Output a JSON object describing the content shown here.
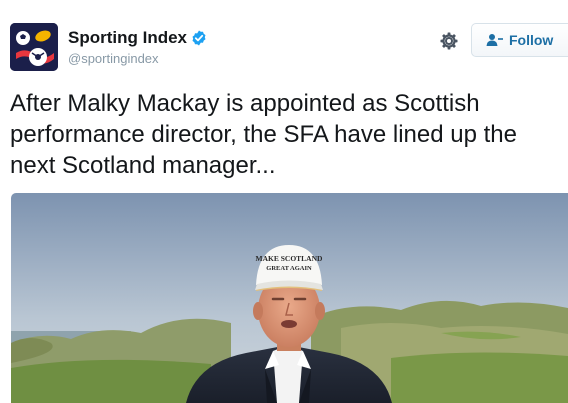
{
  "account": {
    "display_name": "Sporting Index",
    "handle": "@sportingindex",
    "verified": true,
    "avatar_icon": "sporting-index-logo"
  },
  "actions": {
    "settings_icon": "gear-icon",
    "follow_label": "Follow",
    "follow_icon": "add-user-icon"
  },
  "tweet": {
    "text": "After Malky Mackay is appointed as Scottish performance director, the SFA have lined up the next Scotland manager..."
  },
  "media": {
    "cap_text_line1": "MAKE SCOTLAND",
    "cap_text_line2": "GREAT AGAIN"
  },
  "colors": {
    "name": "#14171a",
    "handle": "#8899a6",
    "link": "#1d6fa5",
    "verified": "#1da1f2"
  }
}
